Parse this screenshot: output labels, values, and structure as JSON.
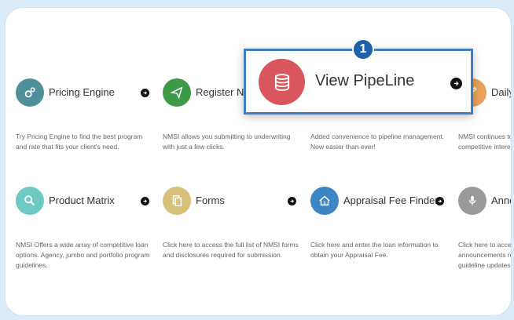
{
  "tiles": [
    {
      "title": "Pricing Engine",
      "desc": "Try Pricing Engine to find the best program and rate that fits your client's need.",
      "icon": "gears-icon",
      "color": "#4e8f9a"
    },
    {
      "title": "Register Ne",
      "desc": "NMSI allows you submitting to underwriting with just a few clicks.",
      "icon": "paper-plane-icon",
      "color": "#3d9a49"
    },
    {
      "title": "",
      "desc": "Added convenience to pipeline management. Now easier than ever!",
      "icon": "",
      "color": ""
    },
    {
      "title": "Daily",
      "desc": "NMSI continues to competitive interes",
      "icon": "pencil-icon",
      "color": "#e8a35a"
    },
    {
      "title": "Product Matrix",
      "desc": "NMSI Offers a wide array of competitive loan options. Agency, jumbo and portfolio program guidelines.",
      "icon": "search-icon",
      "color": "#6fc9c3"
    },
    {
      "title": "Forms",
      "desc": "Click here to access the full list of NMSI forms and disclosures required for submission.",
      "icon": "documents-icon",
      "color": "#d6c07a"
    },
    {
      "title": "Appraisal Fee Finder",
      "desc": "Click here and enter the loan information to obtain your Appraisal Fee.",
      "icon": "house-dollar-icon",
      "color": "#3d86c6"
    },
    {
      "title": "Anno",
      "desc": "Click here to acce announcements re guideline updates.",
      "icon": "microphone-icon",
      "color": "#9a9a9a"
    }
  ],
  "highlight": {
    "title": "View PipeLine",
    "icon": "database-icon",
    "color": "#d9575c",
    "badge": "1"
  }
}
